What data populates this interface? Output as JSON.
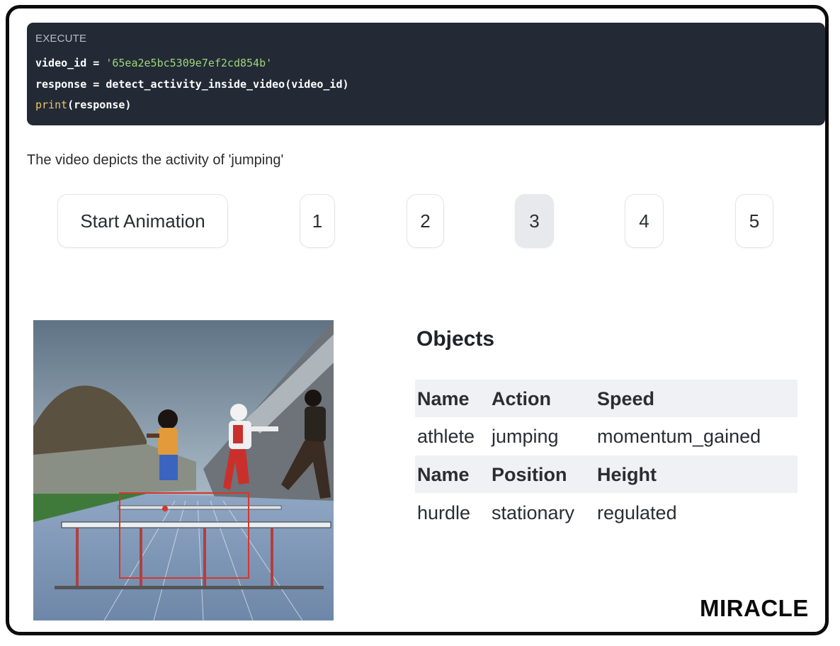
{
  "code_block": {
    "header": "EXECUTE",
    "line1_var": "video_id = ",
    "line1_str": "'65ea2e5bc5309e7ef2cd854b'",
    "line2": "response = detect_activity_inside_video(video_id)",
    "line3_fn": "print",
    "line3_rest": "(response)"
  },
  "result_text": "The video depicts the activity of 'jumping'",
  "controls": {
    "start_label": "Start Animation",
    "frames": [
      "1",
      "2",
      "3",
      "4",
      "5"
    ],
    "active_frame": "3"
  },
  "objects": {
    "title": "Objects",
    "table1": {
      "headers": [
        "Name",
        "Action",
        "Speed"
      ],
      "row": [
        "athlete",
        "jumping",
        "momentum_gained"
      ]
    },
    "table2": {
      "headers": [
        "Name",
        "Position",
        "Height"
      ],
      "row": [
        "hurdle",
        "stationary",
        "regulated"
      ]
    }
  },
  "brand": "MIRACLE",
  "colors": {
    "code_bg": "#232a35",
    "string": "#9fd67a",
    "function": "#e8c56d",
    "bbox": "#d9352b",
    "frame": "#0b0b0b"
  }
}
